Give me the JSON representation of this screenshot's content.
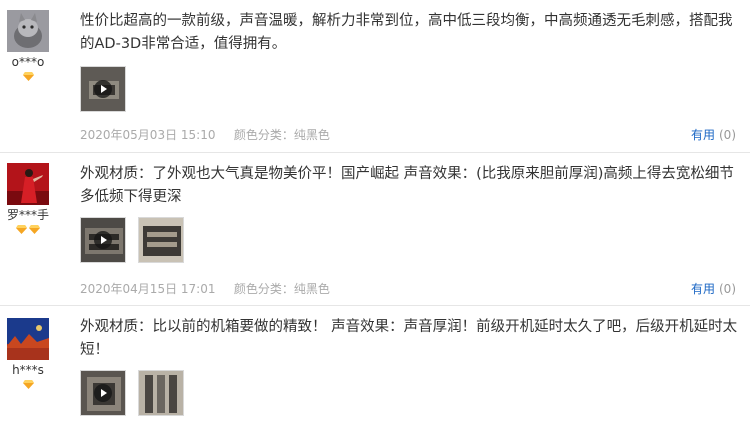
{
  "reviews": [
    {
      "username": "o***o",
      "badge_count": 1,
      "text": "性价比超高的一款前级，声音温暖，解析力非常到位，高中低三段均衡，中高频通透无毛刺感，搭配我的AD-3D非常合适，值得拥有。",
      "date": "2020年05月03日 15:10",
      "color_label": "颜色分类：纯黑色",
      "useful_label": "有用",
      "useful_count": "(0)",
      "thumb_count": 1
    },
    {
      "username": "罗***手",
      "badge_count": 2,
      "text": "外观材质：了外观也大气真是物美价平！国产崛起 声音效果：(比我原来胆前厚润)高频上得去宽松细节多低频下得更深",
      "date": "2020年04月15日 17:01",
      "color_label": "颜色分类：纯黑色",
      "useful_label": "有用",
      "useful_count": "(0)",
      "thumb_count": 2
    },
    {
      "username": "h***s",
      "badge_count": 1,
      "text": "外观材质：比以前的机箱要做的精致！ 声音效果：声音厚润！前级开机延时太久了吧，后级开机延时太短！",
      "date": "",
      "color_label": "",
      "useful_label": "",
      "useful_count": "",
      "thumb_count": 2
    }
  ],
  "colors": {
    "link": "#1a66c4",
    "meta": "#aaaaaa",
    "badge": "#f5a623"
  },
  "icons": {
    "badge": "diamond-icon",
    "video": "play-icon"
  }
}
